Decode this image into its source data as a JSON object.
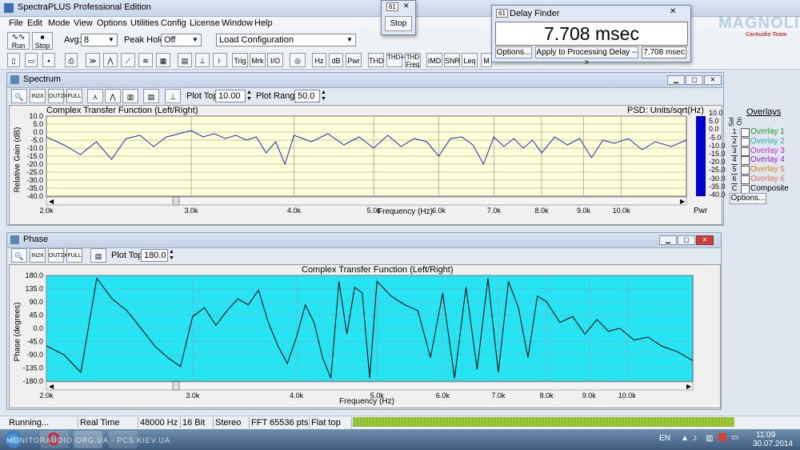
{
  "app": {
    "title": "SpectraPLUS Professional Edition"
  },
  "menu": [
    "File",
    "Edit",
    "Mode",
    "View",
    "Options",
    "Utilities",
    "Config",
    "License",
    "Window",
    "Help"
  ],
  "toolbar": {
    "run_label": "Run",
    "stop_label": "Stop",
    "avg_label": "Avg:",
    "avg_value": "8",
    "peakhold_label": "Peak Hold:",
    "peakhold_value": "Off",
    "load_config": "Load Configuration",
    "buttons2": [
      "Hz",
      "dB",
      "Pwr",
      "THD",
      "THD+N",
      "THD Freq",
      "IMD",
      "SNR",
      "Leq",
      "M"
    ]
  },
  "stop_window": {
    "title_icon": "61",
    "button": "Stop"
  },
  "delay_finder": {
    "title": "Delay Finder",
    "value": "7.708 msec",
    "options": "Options...",
    "apply": "Apply to Processing Delay -->",
    "small_value": "7.708 msec"
  },
  "brand": {
    "name": "MAGNOLIA",
    "sub": "CarAudio Team"
  },
  "spectrum": {
    "window_title": "Spectrum",
    "plot_top_label": "Plot Top:",
    "plot_top": "10.00",
    "plot_range_label": "Plot Range:",
    "plot_range": "50.0",
    "chart_title": "Complex Transfer Function (Left/Right)",
    "psd_label": "PSD: Units/sqrt(Hz)",
    "ylabel": "Relative Gain (dB)",
    "xlabel": "Frequency (Hz)",
    "yticks": [
      "10.0",
      "5.0",
      "0.0",
      "-5.0",
      "-10.0",
      "-15.0",
      "-20.0",
      "-25.0",
      "-30.0",
      "-35.0",
      "-40.0"
    ],
    "xticks": [
      "2.0k",
      "3.0k",
      "4.0k",
      "5.0k",
      "6.0k",
      "7.0k",
      "8.0k",
      "9.0k",
      "10.0k"
    ],
    "pwr_label": "Pwr",
    "overlays_title": "Overlays",
    "set_label": "Set",
    "on_label": "On",
    "overlays": [
      {
        "num": "1",
        "name": "Overlay 1",
        "color": "#20a020"
      },
      {
        "num": "2",
        "name": "Overlay 2",
        "color": "#20b0b0"
      },
      {
        "num": "3",
        "name": "Overlay 3",
        "color": "#c030c0"
      },
      {
        "num": "4",
        "name": "Overlay 4",
        "color": "#a020c0"
      },
      {
        "num": "5",
        "name": "Overlay 5",
        "color": "#e08020"
      },
      {
        "num": "6",
        "name": "Overlay 6",
        "color": "#e07050"
      },
      {
        "num": "C",
        "name": "Composite",
        "color": "#000000"
      }
    ],
    "options_btn": "Options..."
  },
  "phase": {
    "window_title": "Phase",
    "plot_top_label": "Plot Top:",
    "plot_top": "180.0",
    "chart_title": "Complex Transfer Function (Left/Right)",
    "ylabel": "Phase (degrees)",
    "xlabel": "Frequency (Hz)",
    "yticks": [
      "180.0",
      "135.0",
      "90.0",
      "45.0",
      "0.0",
      "-45.0",
      "-90.0",
      "-135.0",
      "-180.0"
    ],
    "xticks": [
      "2.0k",
      "3.0k",
      "4.0k",
      "5.0k",
      "6.0k",
      "7.0k",
      "8.0k",
      "9.0k",
      "10.0k"
    ]
  },
  "status": [
    "Running...",
    "Real Time",
    "48000 Hz",
    "16 Bit",
    "Stereo",
    "FFT 65536 pts",
    "Flat top"
  ],
  "taskbar": {
    "lang": "EN",
    "time": "11:09",
    "date": "30.07.2014",
    "watermark": "MONITORAUDIO.ORG.UA - PCS.KIEV.UA"
  },
  "chart_data": [
    {
      "type": "line",
      "title": "Complex Transfer Function (Left/Right)",
      "xlabel": "Frequency (Hz)",
      "ylabel": "Relative Gain (dB)",
      "xlim": [
        2000,
        12000
      ],
      "ylim": [
        -40,
        10
      ],
      "x_scale": "log",
      "series": [
        {
          "values": [
            [
              2000,
              -3
            ],
            [
              2100,
              -8
            ],
            [
              2200,
              -14
            ],
            [
              2300,
              -6
            ],
            [
              2400,
              -17
            ],
            [
              2500,
              -4
            ],
            [
              2600,
              -2
            ],
            [
              2700,
              -9
            ],
            [
              2800,
              -3
            ],
            [
              2900,
              -1
            ],
            [
              3000,
              1
            ],
            [
              3100,
              -3
            ],
            [
              3200,
              -1
            ],
            [
              3300,
              -4
            ],
            [
              3400,
              -2
            ],
            [
              3500,
              -5
            ],
            [
              3600,
              -3
            ],
            [
              3700,
              -13
            ],
            [
              3800,
              -6
            ],
            [
              3900,
              -20
            ],
            [
              4000,
              -2
            ],
            [
              4200,
              -6
            ],
            [
              4400,
              -1
            ],
            [
              4600,
              -8
            ],
            [
              4800,
              -3
            ],
            [
              5000,
              -10
            ],
            [
              5200,
              -2
            ],
            [
              5400,
              -9
            ],
            [
              5600,
              -4
            ],
            [
              5800,
              -6
            ],
            [
              6000,
              -15
            ],
            [
              6200,
              -4
            ],
            [
              6400,
              -3
            ],
            [
              6600,
              -8
            ],
            [
              6800,
              -20
            ],
            [
              7000,
              -3
            ],
            [
              7200,
              -9
            ],
            [
              7400,
              -4
            ],
            [
              7600,
              -10
            ],
            [
              7800,
              -5
            ],
            [
              8000,
              -13
            ],
            [
              8300,
              -3
            ],
            [
              8600,
              -8
            ],
            [
              8900,
              -4
            ],
            [
              9200,
              -16
            ],
            [
              9500,
              -5
            ],
            [
              9800,
              -7
            ],
            [
              10200,
              -4
            ],
            [
              10600,
              -11
            ],
            [
              11000,
              -6
            ],
            [
              11500,
              -9
            ],
            [
              12000,
              -5
            ]
          ]
        }
      ]
    },
    {
      "type": "line",
      "title": "Complex Transfer Function (Left/Right)",
      "xlabel": "Frequency (Hz)",
      "ylabel": "Phase (degrees)",
      "xlim": [
        2000,
        12000
      ],
      "ylim": [
        -180,
        180
      ],
      "x_scale": "log",
      "series": [
        {
          "values": [
            [
              2000,
              -60
            ],
            [
              2100,
              -90
            ],
            [
              2200,
              -150
            ],
            [
              2300,
              170
            ],
            [
              2400,
              100
            ],
            [
              2500,
              60
            ],
            [
              2600,
              0
            ],
            [
              2700,
              -60
            ],
            [
              2800,
              -100
            ],
            [
              2900,
              -130
            ],
            [
              3000,
              40
            ],
            [
              3100,
              70
            ],
            [
              3200,
              10
            ],
            [
              3300,
              60
            ],
            [
              3400,
              100
            ],
            [
              3500,
              80
            ],
            [
              3600,
              130
            ],
            [
              3700,
              20
            ],
            [
              3800,
              -60
            ],
            [
              3900,
              -120
            ],
            [
              4000,
              -30
            ],
            [
              4100,
              80
            ],
            [
              4200,
              20
            ],
            [
              4300,
              -100
            ],
            [
              4400,
              -170
            ],
            [
              4500,
              160
            ],
            [
              4600,
              -20
            ],
            [
              4700,
              140
            ],
            [
              4800,
              120
            ],
            [
              4900,
              -170
            ],
            [
              5000,
              160
            ],
            [
              5200,
              110
            ],
            [
              5400,
              80
            ],
            [
              5600,
              60
            ],
            [
              5800,
              -100
            ],
            [
              6000,
              120
            ],
            [
              6200,
              -170
            ],
            [
              6400,
              140
            ],
            [
              6600,
              -140
            ],
            [
              6800,
              170
            ],
            [
              7000,
              -150
            ],
            [
              7200,
              160
            ],
            [
              7400,
              70
            ],
            [
              7600,
              -100
            ],
            [
              7800,
              110
            ],
            [
              8000,
              90
            ],
            [
              8300,
              20
            ],
            [
              8600,
              40
            ],
            [
              8900,
              -20
            ],
            [
              9200,
              30
            ],
            [
              9500,
              -10
            ],
            [
              9800,
              0
            ],
            [
              10200,
              -40
            ],
            [
              10600,
              -30
            ],
            [
              11000,
              -60
            ],
            [
              11500,
              -80
            ],
            [
              12000,
              -110
            ]
          ]
        }
      ]
    }
  ]
}
